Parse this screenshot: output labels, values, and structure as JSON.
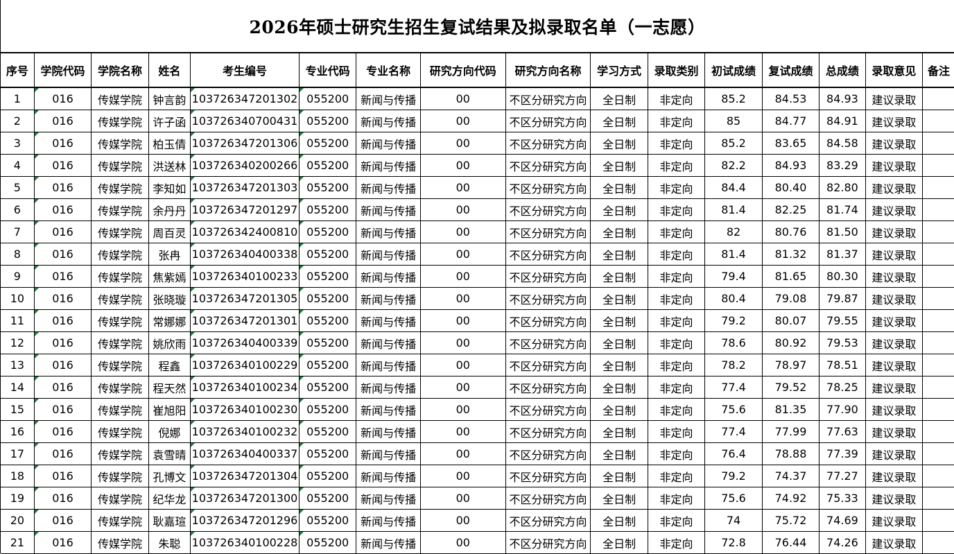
{
  "title": "2026年硕士研究生招生复试结果及拟录取名单（一志愿）",
  "columns": [
    "序号",
    "学院代码",
    "学院名称",
    "姓名",
    "考生编号",
    "专业代码",
    "专业名称",
    "研究方向代码",
    "研究方向名称",
    "学习方式",
    "录取类别",
    "初试成绩",
    "复试成绩",
    "总成绩",
    "录取意见",
    "备注"
  ],
  "rows": [
    [
      "1",
      "016",
      "传媒学院",
      "钟言韵",
      "103726347201302",
      "055200",
      "新闻与传播",
      "00",
      "不区分研究方向",
      "全日制",
      "非定向",
      "85.2",
      "84.53",
      "84.93",
      "建议录取",
      ""
    ],
    [
      "2",
      "016",
      "传媒学院",
      "许子函",
      "103726340700431",
      "055200",
      "新闻与传播",
      "00",
      "不区分研究方向",
      "全日制",
      "非定向",
      "85",
      "84.77",
      "84.91",
      "建议录取",
      ""
    ],
    [
      "3",
      "016",
      "传媒学院",
      "柏玉倩",
      "103726347201306",
      "055200",
      "新闻与传播",
      "00",
      "不区分研究方向",
      "全日制",
      "非定向",
      "85.2",
      "83.65",
      "84.58",
      "建议录取",
      ""
    ],
    [
      "4",
      "016",
      "传媒学院",
      "洪送林",
      "103726340200266",
      "055200",
      "新闻与传播",
      "00",
      "不区分研究方向",
      "全日制",
      "非定向",
      "82.2",
      "84.93",
      "83.29",
      "建议录取",
      ""
    ],
    [
      "5",
      "016",
      "传媒学院",
      "李知如",
      "103726347201303",
      "055200",
      "新闻与传播",
      "00",
      "不区分研究方向",
      "全日制",
      "非定向",
      "84.4",
      "80.40",
      "82.80",
      "建议录取",
      ""
    ],
    [
      "6",
      "016",
      "传媒学院",
      "余丹丹",
      "103726347201297",
      "055200",
      "新闻与传播",
      "00",
      "不区分研究方向",
      "全日制",
      "非定向",
      "81.4",
      "82.25",
      "81.74",
      "建议录取",
      ""
    ],
    [
      "7",
      "016",
      "传媒学院",
      "周百灵",
      "103726342400810",
      "055200",
      "新闻与传播",
      "00",
      "不区分研究方向",
      "全日制",
      "非定向",
      "82",
      "80.76",
      "81.50",
      "建议录取",
      ""
    ],
    [
      "8",
      "016",
      "传媒学院",
      "张冉",
      "103726340400338",
      "055200",
      "新闻与传播",
      "00",
      "不区分研究方向",
      "全日制",
      "非定向",
      "81.4",
      "81.32",
      "81.37",
      "建议录取",
      ""
    ],
    [
      "9",
      "016",
      "传媒学院",
      "焦紫嫣",
      "103726340100233",
      "055200",
      "新闻与传播",
      "00",
      "不区分研究方向",
      "全日制",
      "非定向",
      "79.4",
      "81.65",
      "80.30",
      "建议录取",
      ""
    ],
    [
      "10",
      "016",
      "传媒学院",
      "张晓璇",
      "103726347201305",
      "055200",
      "新闻与传播",
      "00",
      "不区分研究方向",
      "全日制",
      "非定向",
      "80.4",
      "79.08",
      "79.87",
      "建议录取",
      ""
    ],
    [
      "11",
      "016",
      "传媒学院",
      "常娜娜",
      "103726347201301",
      "055200",
      "新闻与传播",
      "00",
      "不区分研究方向",
      "全日制",
      "非定向",
      "79.2",
      "80.07",
      "79.55",
      "建议录取",
      ""
    ],
    [
      "12",
      "016",
      "传媒学院",
      "姚欣雨",
      "103726340400339",
      "055200",
      "新闻与传播",
      "00",
      "不区分研究方向",
      "全日制",
      "非定向",
      "78.6",
      "80.92",
      "79.53",
      "建议录取",
      ""
    ],
    [
      "13",
      "016",
      "传媒学院",
      "程鑫",
      "103726340100229",
      "055200",
      "新闻与传播",
      "00",
      "不区分研究方向",
      "全日制",
      "非定向",
      "78.2",
      "78.97",
      "78.51",
      "建议录取",
      ""
    ],
    [
      "14",
      "016",
      "传媒学院",
      "程天然",
      "103726340100234",
      "055200",
      "新闻与传播",
      "00",
      "不区分研究方向",
      "全日制",
      "非定向",
      "77.4",
      "79.52",
      "78.25",
      "建议录取",
      ""
    ],
    [
      "15",
      "016",
      "传媒学院",
      "崔旭阳",
      "103726340100230",
      "055200",
      "新闻与传播",
      "00",
      "不区分研究方向",
      "全日制",
      "非定向",
      "75.6",
      "81.35",
      "77.90",
      "建议录取",
      ""
    ],
    [
      "16",
      "016",
      "传媒学院",
      "倪娜",
      "103726340100232",
      "055200",
      "新闻与传播",
      "00",
      "不区分研究方向",
      "全日制",
      "非定向",
      "77.4",
      "77.99",
      "77.63",
      "建议录取",
      ""
    ],
    [
      "17",
      "016",
      "传媒学院",
      "袁雪晴",
      "103726340400337",
      "055200",
      "新闻与传播",
      "00",
      "不区分研究方向",
      "全日制",
      "非定向",
      "76.4",
      "78.88",
      "77.39",
      "建议录取",
      ""
    ],
    [
      "18",
      "016",
      "传媒学院",
      "孔博文",
      "103726347201304",
      "055200",
      "新闻与传播",
      "00",
      "不区分研究方向",
      "全日制",
      "非定向",
      "79.2",
      "74.37",
      "77.27",
      "建议录取",
      ""
    ],
    [
      "19",
      "016",
      "传媒学院",
      "纪华龙",
      "103726347201300",
      "055200",
      "新闻与传播",
      "00",
      "不区分研究方向",
      "全日制",
      "非定向",
      "75.6",
      "74.92",
      "75.33",
      "建议录取",
      ""
    ],
    [
      "20",
      "016",
      "传媒学院",
      "耿嘉瑄",
      "103726347201296",
      "055200",
      "新闻与传播",
      "00",
      "不区分研究方向",
      "全日制",
      "非定向",
      "74",
      "75.72",
      "74.69",
      "建议录取",
      ""
    ],
    [
      "21",
      "016",
      "传媒学院",
      "朱聪",
      "103726340100228",
      "055200",
      "新闻与传播",
      "00",
      "不区分研究方向",
      "全日制",
      "非定向",
      "72.8",
      "76.44",
      "74.26",
      "建议录取",
      ""
    ]
  ],
  "colors": {
    "cell_marker": "#1b7a3b",
    "grid": "#000000"
  }
}
